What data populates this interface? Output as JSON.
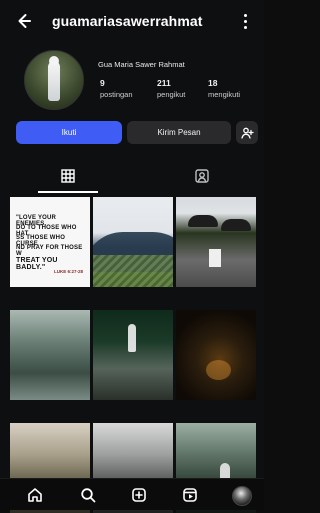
{
  "header": {
    "username": "guamariasawerrahmat"
  },
  "profile": {
    "display_name": "Gua Maria Sawer Rahmat",
    "stats": [
      {
        "value": "9",
        "label": "postingan"
      },
      {
        "value": "211",
        "label": "pengikut"
      },
      {
        "value": "18",
        "label": "mengikuti"
      }
    ]
  },
  "actions": {
    "follow_label": "Ikuti",
    "message_label": "Kirim Pesan"
  },
  "grid": {
    "posts": [
      {
        "quote_lines": [
          "\"LOVE YOUR ENEMIES,",
          "DO TO THOSE WHO HAT",
          "SS THOSE WHO CURSE",
          "ND PRAY FOR THOSE W",
          "TREAT YOU BADLY.\""
        ],
        "citation": "LUKE 6:27-28"
      }
    ]
  },
  "colors": {
    "background": "#0e0f11",
    "primary_button": "#3f5cf5",
    "secondary_button": "#2a2a2c"
  }
}
